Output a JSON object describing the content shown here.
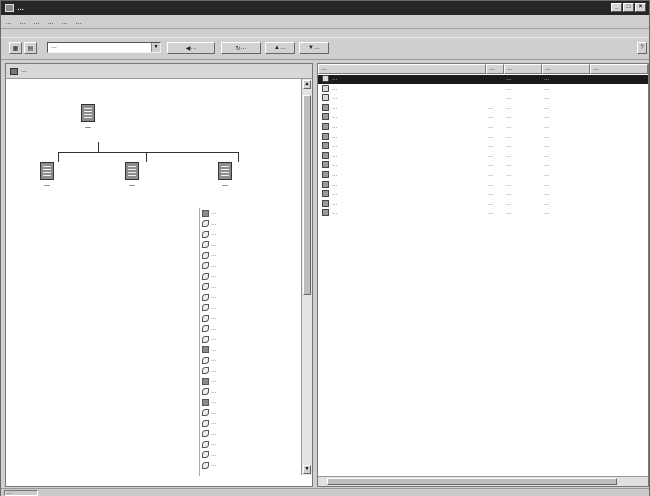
{
  "window": {
    "title": "…",
    "controls": [
      "minimize-icon",
      "maximize-icon",
      "close-icon"
    ]
  },
  "menu": [
    "…",
    "…",
    "…",
    "…",
    "…",
    "…"
  ],
  "toolbar": {
    "site_combo_value": "…",
    "buttons": [
      {
        "name": "back",
        "label": "…"
      },
      {
        "name": "refresh",
        "label": "…"
      },
      {
        "name": "up",
        "label": "…"
      },
      {
        "name": "down",
        "label": "…"
      }
    ]
  },
  "navigator": {
    "header": "…",
    "root": "…",
    "children": [
      "…",
      "…",
      "…"
    ],
    "links": [
      "…",
      "…",
      "…",
      "…",
      "…",
      "…",
      "…",
      "…",
      "…",
      "…",
      "…",
      "…",
      "…",
      "…",
      "…",
      "…",
      "…",
      "…",
      "…",
      "…",
      "…",
      "…",
      "…",
      "…",
      "…"
    ]
  },
  "filelist": {
    "columns": [
      "…",
      "…",
      "…",
      "…",
      "…"
    ],
    "rows": [
      {
        "name": "…",
        "size": "",
        "type": "…",
        "modified": "…",
        "selected": true,
        "icon": "folder-icon"
      },
      {
        "name": "…",
        "size": "",
        "type": "…",
        "modified": "…",
        "icon": "folder-icon"
      },
      {
        "name": "…",
        "size": "",
        "type": "…",
        "modified": "…",
        "icon": "folder-icon"
      },
      {
        "name": "…",
        "size": "…",
        "type": "…",
        "modified": "…",
        "icon": "page-icon"
      },
      {
        "name": "…",
        "size": "…",
        "type": "…",
        "modified": "…",
        "icon": "page-icon"
      },
      {
        "name": "…",
        "size": "…",
        "type": "…",
        "modified": "…",
        "icon": "page-icon"
      },
      {
        "name": "…",
        "size": "…",
        "type": "…",
        "modified": "…",
        "icon": "page-icon"
      },
      {
        "name": "…",
        "size": "…",
        "type": "…",
        "modified": "…",
        "icon": "page-icon"
      },
      {
        "name": "…",
        "size": "…",
        "type": "…",
        "modified": "…",
        "icon": "page-icon"
      },
      {
        "name": "…",
        "size": "…",
        "type": "…",
        "modified": "…",
        "icon": "page-icon"
      },
      {
        "name": "…",
        "size": "…",
        "type": "…",
        "modified": "…",
        "icon": "page-icon"
      },
      {
        "name": "…",
        "size": "…",
        "type": "…",
        "modified": "…",
        "icon": "page-icon"
      },
      {
        "name": "…",
        "size": "…",
        "type": "…",
        "modified": "…",
        "icon": "page-icon"
      },
      {
        "name": "…",
        "size": "…",
        "type": "…",
        "modified": "…",
        "icon": "page-icon"
      },
      {
        "name": "…",
        "size": "…",
        "type": "…",
        "modified": "…",
        "icon": "page-icon"
      }
    ]
  },
  "status": {
    "text": "…"
  }
}
